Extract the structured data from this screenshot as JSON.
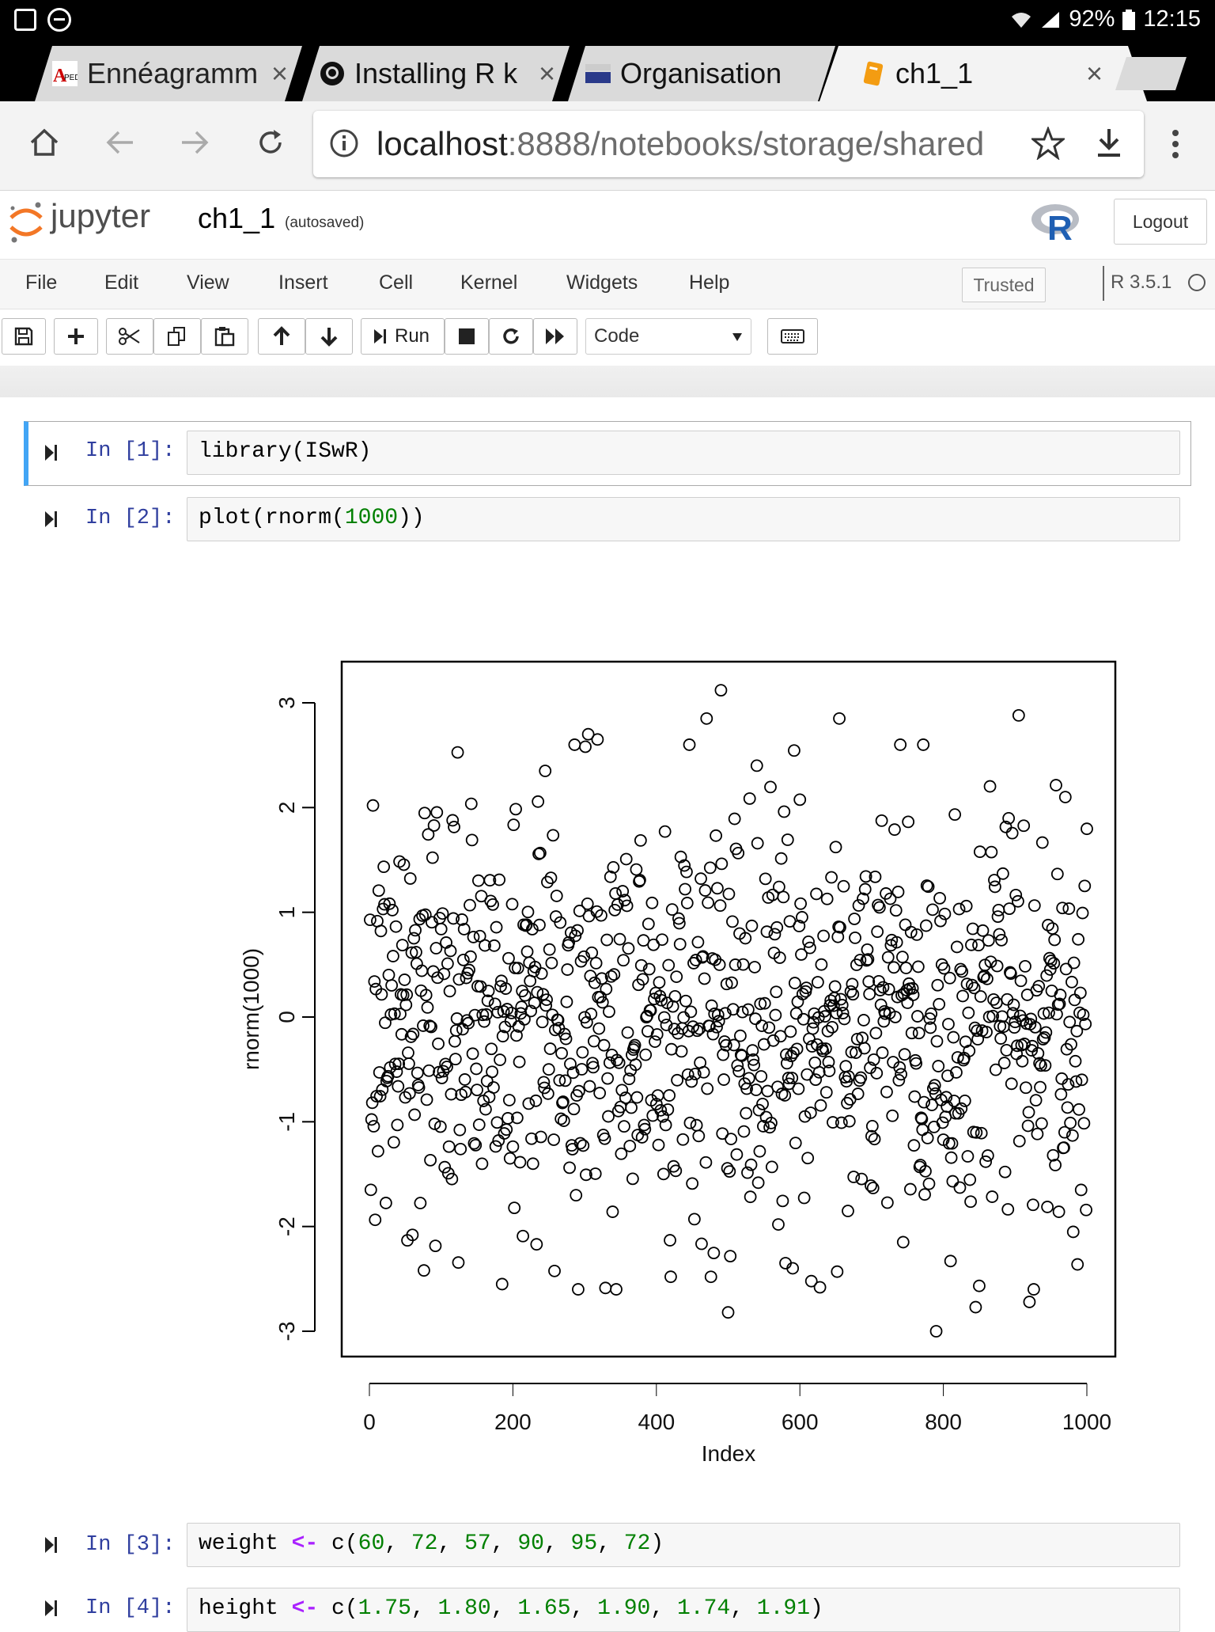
{
  "status": {
    "battery": "92%",
    "time": "12:15"
  },
  "tabs": [
    {
      "title": "Ennéagramm",
      "favicon": "aped-favicon",
      "close": "×"
    },
    {
      "title": "Installing R k",
      "favicon": "github-favicon",
      "close": "×"
    },
    {
      "title": "Organisation",
      "favicon": "institut-favicon"
    },
    {
      "title": "ch1_1",
      "favicon": "jupyter-notebook-favicon",
      "close": "×",
      "active": true
    }
  ],
  "address": {
    "host": "localhost",
    "rest": ":8888/notebooks/storage/shared"
  },
  "header": {
    "logo_text": "jupyter",
    "notebook_name": "ch1_1",
    "save_status": "(autosaved)",
    "logout": "Logout",
    "kernel_logo": "R"
  },
  "menu": [
    "File",
    "Edit",
    "View",
    "Insert",
    "Cell",
    "Kernel",
    "Widgets",
    "Help"
  ],
  "trusted": "Trusted",
  "kernel_name": "R 3.5.1",
  "toolbar": {
    "run_label": "Run",
    "cell_type": "Code"
  },
  "cells": [
    {
      "prompt": "In [1]:",
      "code": "library(ISwR)",
      "selected": true
    },
    {
      "prompt": "In [2]:",
      "code": "plot(rnorm(1000))"
    },
    {
      "prompt": "In [3]:",
      "code": "weight <- c(60, 72, 57, 90, 95, 72)"
    },
    {
      "prompt": "In [4]:",
      "code": "height <- c(1.75, 1.80, 1.65, 1.90, 1.74, 1.91)"
    }
  ],
  "chart_data": {
    "type": "scatter",
    "xlabel": "Index",
    "ylabel": "rnorm(1000)",
    "xlim": [
      0,
      1000
    ],
    "ylim": [
      -3,
      3
    ],
    "xticks": [
      0,
      200,
      400,
      600,
      800,
      1000
    ],
    "yticks": [
      -3,
      -2,
      -1,
      0,
      1,
      2,
      3
    ],
    "n_points": 1000,
    "marker": "open-circle",
    "grid": false,
    "legend": "none",
    "highlighted_values": [
      {
        "x": 490,
        "y": 3.12
      },
      {
        "x": 470,
        "y": 2.85
      },
      {
        "x": 655,
        "y": 2.85
      },
      {
        "x": 905,
        "y": 2.88
      },
      {
        "x": 305,
        "y": 2.7
      },
      {
        "x": 318,
        "y": 2.65
      },
      {
        "x": 540,
        "y": 2.4
      },
      {
        "x": 245,
        "y": 2.35
      },
      {
        "x": 500,
        "y": -2.82
      },
      {
        "x": 790,
        "y": -3.0
      },
      {
        "x": 845,
        "y": -2.77
      },
      {
        "x": 920,
        "y": -2.72
      },
      {
        "x": 185,
        "y": -2.55
      },
      {
        "x": 420,
        "y": -2.48
      },
      {
        "x": 580,
        "y": -2.35
      },
      {
        "x": 810,
        "y": -2.33
      },
      {
        "x": 60,
        "y": -2.08
      },
      {
        "x": 2,
        "y": -1.65
      },
      {
        "x": 5,
        "y": 2.02
      },
      {
        "x": 970,
        "y": 2.1
      }
    ]
  }
}
